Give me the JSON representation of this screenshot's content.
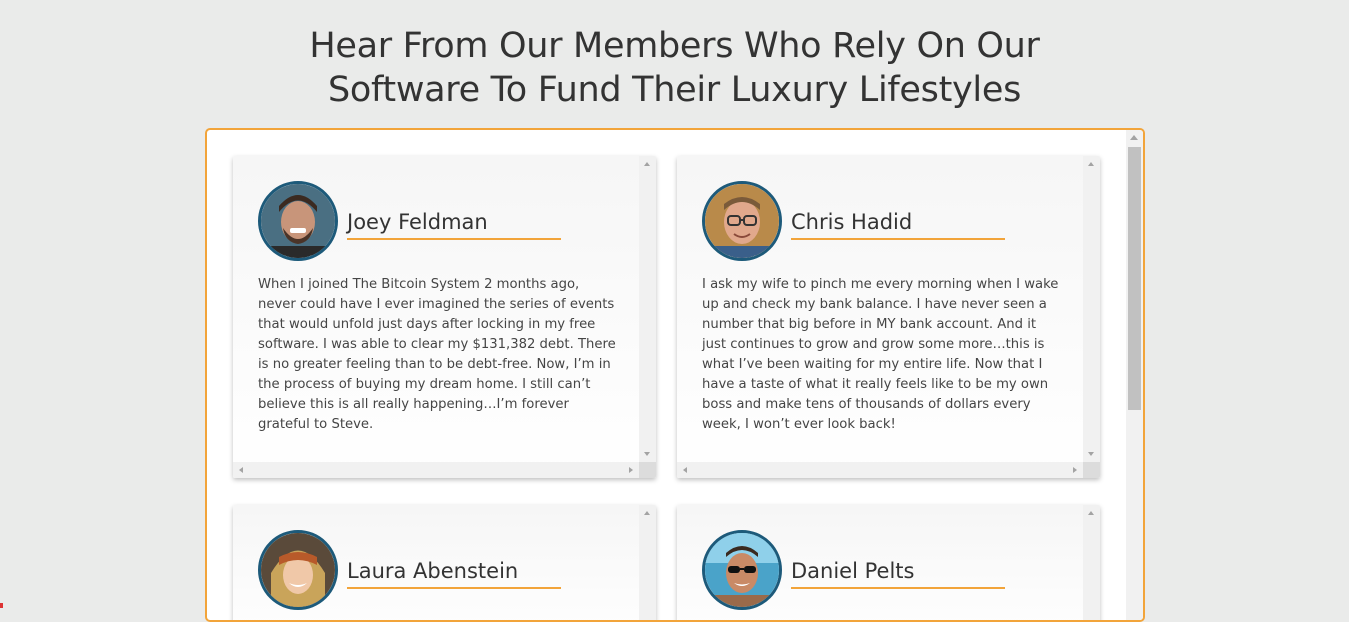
{
  "headline": {
    "line1": "Hear From Our Members Who Rely On Our",
    "line2": "Software To Fund Their Luxury Lifestyles"
  },
  "colors": {
    "accent": "#f2a43a",
    "avatar_ring": "#1d5a7a",
    "background": "#eaebea"
  },
  "testimonials": [
    {
      "name": "Joey Feldman",
      "avatar_icon": "avatar-photo",
      "quote": "When I joined The Bitcoin System 2 months ago, never could have I ever imagined the series of events that would unfold just days after locking in my free software. I was able to clear my $131,382 debt. There is no greater feeling than to be debt-free. Now, I’m in the process of buying my dream home. I still can’t believe this is all really happening…I’m forever grateful to Steve."
    },
    {
      "name": "Chris Hadid",
      "avatar_icon": "avatar-photo",
      "quote": "I ask my wife to pinch me every morning when I wake up and check my bank balance. I have never seen a number that big before in MY bank account. And it just continues to grow and grow some more…this is what I’ve been waiting for my entire life. Now that I have a taste of what it really feels like to be my own boss and make tens of thousands of dollars every week, I won’t ever look back!"
    },
    {
      "name": "Laura Abenstein",
      "avatar_icon": "avatar-photo"
    },
    {
      "name": "Daniel Pelts",
      "avatar_icon": "avatar-photo"
    }
  ]
}
